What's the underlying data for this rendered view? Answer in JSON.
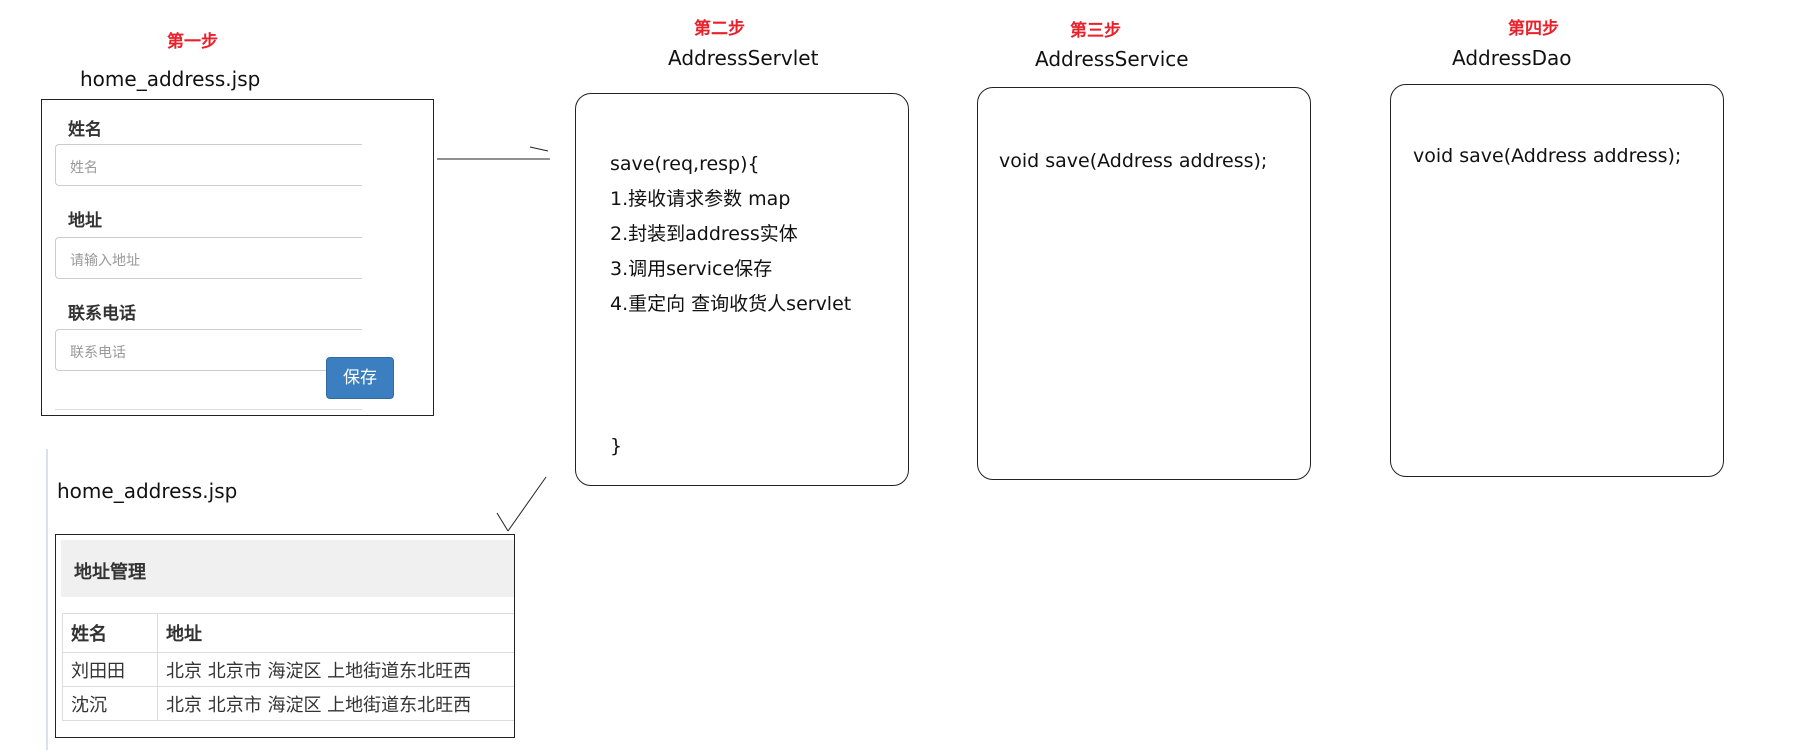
{
  "steps": [
    {
      "step_label": "第一步",
      "title": "home_address.jsp",
      "form": {
        "fields": [
          {
            "label": "姓名",
            "placeholder": "姓名"
          },
          {
            "label": "地址",
            "placeholder": "请输入地址"
          },
          {
            "label": "联系电话",
            "placeholder": "联系电话"
          }
        ],
        "save_label": "保存"
      }
    },
    {
      "step_label": "第二步",
      "title": "AddressServlet",
      "code_lines": [
        "save(req,resp){",
        "1.接收请求参数 map",
        "2.封装到address实体",
        "3.调用service保存",
        "4.重定向 查询收货人servlet"
      ],
      "closing_brace": "}"
    },
    {
      "step_label": "第三步",
      "title": "AddressService",
      "code_lines": [
        "void save(Address address);"
      ]
    },
    {
      "step_label": "第四步",
      "title": "AddressDao",
      "code_lines": [
        "void save(Address address);"
      ]
    }
  ],
  "result_page": {
    "title": "home_address.jsp",
    "panel_title": "地址管理",
    "columns": [
      "姓名",
      "地址"
    ],
    "rows": [
      [
        "刘田田",
        "北京 北京市 海淀区 上地街道东北旺西"
      ],
      [
        "沈沉",
        "北京 北京市 海淀区 上地街道东北旺西"
      ]
    ]
  },
  "colors": {
    "step_label": "#e8212b",
    "button": "#3b7fc0",
    "border": "#222222"
  }
}
